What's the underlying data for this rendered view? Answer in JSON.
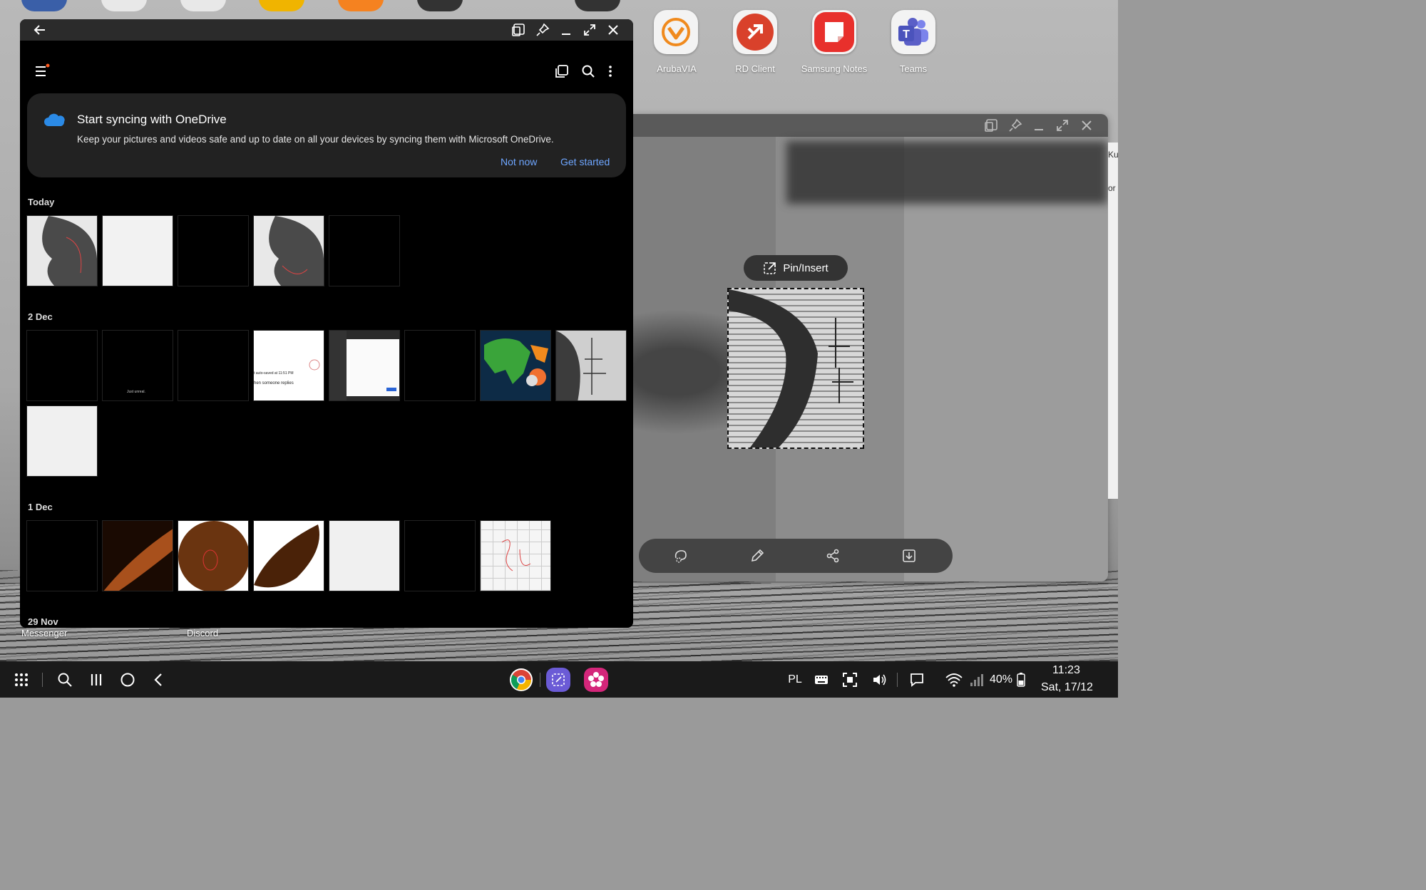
{
  "desktop": {
    "apps": [
      {
        "label": "ArubaVIA",
        "icon": "arubavia-icon"
      },
      {
        "label": "RD Client",
        "icon": "rd-client-icon"
      },
      {
        "label": "Samsung Notes",
        "icon": "samsung-notes-icon"
      },
      {
        "label": "Teams",
        "icon": "teams-icon"
      }
    ],
    "bottom_labels": [
      "Messenger",
      "Discord"
    ]
  },
  "gallery": {
    "sync_card": {
      "title": "Start syncing with OneDrive",
      "description": "Keep your pictures and videos safe and up to date on all your devices by syncing them with Microsoft OneDrive.",
      "not_now": "Not now",
      "get_started": "Get started"
    },
    "sections": [
      {
        "label": "Today",
        "count": 5
      },
      {
        "label": "2 Dec",
        "count": 9
      },
      {
        "label": "1 Dec",
        "count": 7
      },
      {
        "label": "29 Nov",
        "count": 0
      }
    ],
    "thumb_texts": {
      "just_unreal": "Just unreal.",
      "auto_saved": "t auto-saved at 11:51 PM",
      "replies": "hen someone replies"
    }
  },
  "editor": {
    "pin_insert": "Pin/Insert",
    "side_texts": [
      "Ku",
      "or"
    ]
  },
  "taskbar": {
    "language": "PL",
    "battery": "40%",
    "time": "11:23",
    "date": "Sat, 17/12"
  },
  "colors": {
    "accent_link": "#6ea6ff",
    "rd_client": "#d9412b",
    "samsung_notes": "#e8302c",
    "teams": "#5b5fc7",
    "arubavia": "#f08a1d"
  }
}
